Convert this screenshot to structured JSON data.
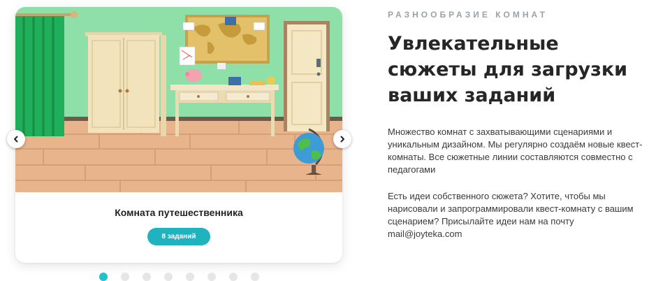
{
  "slider": {
    "slide": {
      "title": "Комната путешественника",
      "badge": "8 заданий"
    },
    "dots": {
      "total": 8,
      "active_index": 0
    },
    "colors": {
      "accent": "#1fb3bf",
      "dot_active": "#1fc2cf",
      "dot_inactive": "#e4e6e8"
    }
  },
  "section": {
    "eyebrow": "РАЗНООБРАЗИЕ КОМНАТ",
    "heading": "Увлекательные сюжеты для загрузки ваших заданий",
    "paragraph1": "Множество комнат с захватывающими сценариями и уникальным дизайном. Мы регулярно создаём новые квест-комнаты. Все сюжетные линии составляются совместно с педагогами",
    "paragraph2": "Есть идеи собственного сюжета? Хотите, чтобы мы нарисовали и запрограммировали квест-комнату с вашим сценарием? Присылайте идеи нам на почту mail@joyteka.com"
  },
  "icons": {
    "prev": "chevron-left-icon",
    "next": "chevron-right-icon"
  }
}
